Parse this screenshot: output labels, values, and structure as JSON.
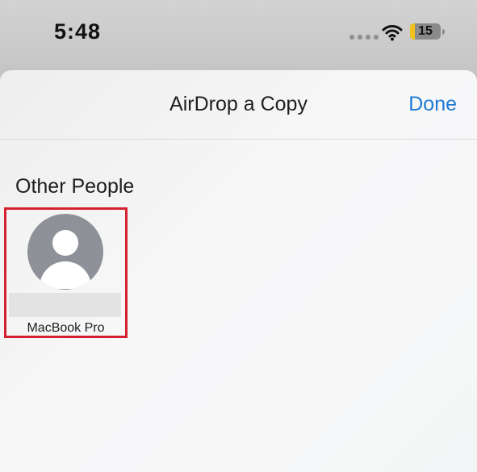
{
  "status_bar": {
    "time": "5:48",
    "signal_icon": "cellular-dots-icon",
    "wifi_icon": "wifi-icon",
    "battery_icon": "battery-icon",
    "battery_level": "15",
    "battery_fill_fraction": 0.15,
    "battery_fill_color": "#f2c21b"
  },
  "sheet": {
    "title": "AirDrop a Copy",
    "done_label": "Done",
    "accent_color": "#1e7ad6",
    "section_title": "Other People",
    "devices": [
      {
        "name": "MacBook Pro",
        "avatar_icon": "person-avatar-icon"
      }
    ]
  }
}
